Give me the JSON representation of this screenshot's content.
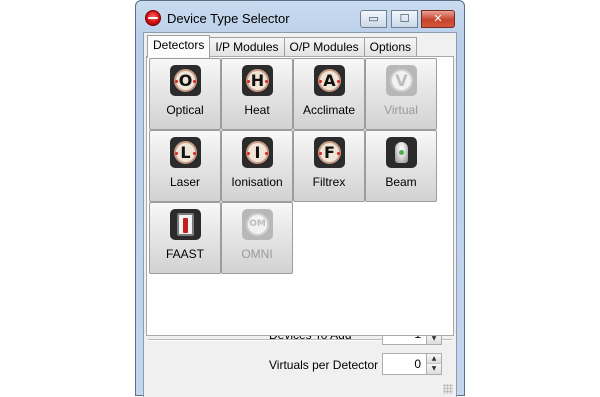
{
  "window": {
    "title": "Device Type Selector",
    "buttons": {
      "minimize": "▭",
      "maximize": "☐",
      "close": "✕"
    }
  },
  "tabs": [
    {
      "label": "Detectors",
      "active": true
    },
    {
      "label": "I/P Modules",
      "active": false
    },
    {
      "label": "O/P Modules",
      "active": false
    },
    {
      "label": "Options",
      "active": false
    }
  ],
  "devices": [
    {
      "label": "Optical",
      "glyph": "O",
      "icon": "optical-icon",
      "enabled": true
    },
    {
      "label": "Heat",
      "glyph": "H",
      "icon": "heat-icon",
      "enabled": true
    },
    {
      "label": "Acclimate",
      "glyph": "A",
      "icon": "acclimate-icon",
      "enabled": true
    },
    {
      "label": "Virtual",
      "glyph": "V",
      "icon": "virtual-icon",
      "enabled": false
    },
    {
      "label": "Laser",
      "glyph": "L",
      "icon": "laser-icon",
      "enabled": true
    },
    {
      "label": "Ionisation",
      "glyph": "I",
      "icon": "ionisation-icon",
      "enabled": true
    },
    {
      "label": "Filtrex",
      "glyph": "F",
      "icon": "filtrex-icon",
      "enabled": true
    },
    {
      "label": "Beam",
      "glyph": "",
      "icon": "beam-icon",
      "enabled": true
    },
    {
      "label": "FAAST",
      "glyph": "",
      "icon": "faast-icon",
      "enabled": true
    },
    {
      "label": "OMNI",
      "glyph": "OM",
      "icon": "omni-icon",
      "enabled": false
    }
  ],
  "options": {
    "devices_to_add_label": "Devices To Add",
    "devices_to_add_value": "1",
    "virtuals_label": "Virtuals per Detector",
    "virtuals_value": "0"
  },
  "colors": {
    "title_accent": "#c7422c",
    "disabled_text": "#9a9a9a"
  }
}
